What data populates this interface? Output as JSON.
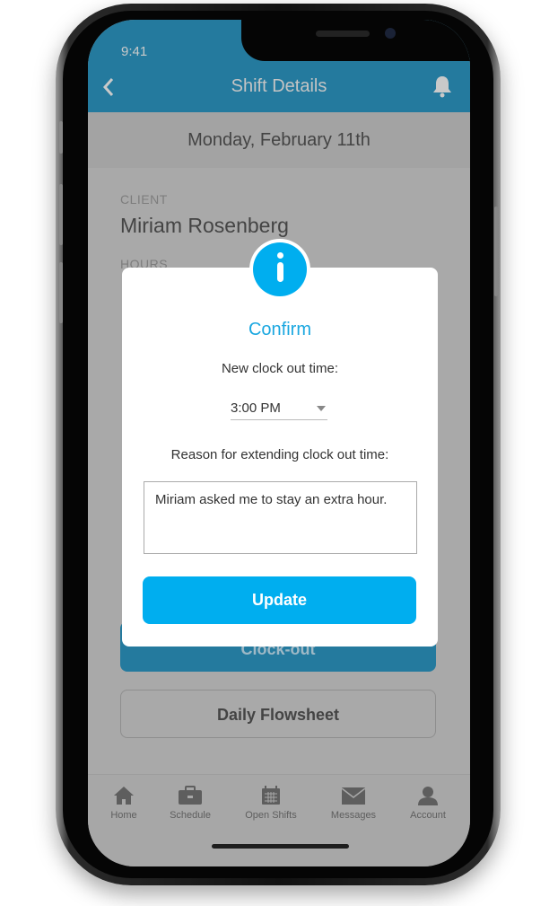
{
  "status_bar": {
    "time": "9:41"
  },
  "header": {
    "title": "Shift Details",
    "back_icon": "chevron-left-icon",
    "bell_icon": "bell-icon"
  },
  "date": "Monday, February 11th",
  "client": {
    "label": "CLIENT",
    "name": "Miriam Rosenberg"
  },
  "hours": {
    "label": "HOURS"
  },
  "buttons": {
    "clock_out": "Clock-out",
    "flowsheet": "Daily Flowsheet"
  },
  "tabs": [
    {
      "label": "Home",
      "icon": "home-icon"
    },
    {
      "label": "Schedule",
      "icon": "briefcase-icon"
    },
    {
      "label": "Open Shifts",
      "icon": "calendar-icon"
    },
    {
      "label": "Messages",
      "icon": "envelope-icon"
    },
    {
      "label": "Account",
      "icon": "user-icon"
    }
  ],
  "modal": {
    "title": "Confirm",
    "time_label": "New clock out time:",
    "time_value": "3:00 PM",
    "reason_label": "Reason for extending clock out time:",
    "reason_value": "Miriam asked me to stay an extra hour.",
    "update": "Update",
    "icon": "info-icon"
  },
  "colors": {
    "accent": "#00aeef",
    "header": "#2a8bb3"
  }
}
